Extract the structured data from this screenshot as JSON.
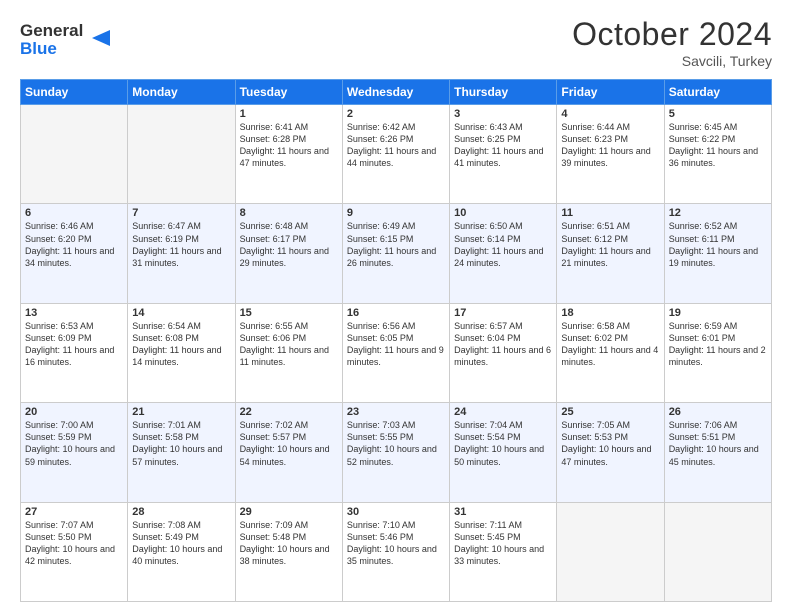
{
  "header": {
    "logo_line1": "General",
    "logo_line2": "Blue",
    "month": "October 2024",
    "location": "Savcili, Turkey"
  },
  "weekdays": [
    "Sunday",
    "Monday",
    "Tuesday",
    "Wednesday",
    "Thursday",
    "Friday",
    "Saturday"
  ],
  "weeks": [
    [
      {
        "day": "",
        "sunrise": "",
        "sunset": "",
        "daylight": ""
      },
      {
        "day": "",
        "sunrise": "",
        "sunset": "",
        "daylight": ""
      },
      {
        "day": "1",
        "sunrise": "Sunrise: 6:41 AM",
        "sunset": "Sunset: 6:28 PM",
        "daylight": "Daylight: 11 hours and 47 minutes."
      },
      {
        "day": "2",
        "sunrise": "Sunrise: 6:42 AM",
        "sunset": "Sunset: 6:26 PM",
        "daylight": "Daylight: 11 hours and 44 minutes."
      },
      {
        "day": "3",
        "sunrise": "Sunrise: 6:43 AM",
        "sunset": "Sunset: 6:25 PM",
        "daylight": "Daylight: 11 hours and 41 minutes."
      },
      {
        "day": "4",
        "sunrise": "Sunrise: 6:44 AM",
        "sunset": "Sunset: 6:23 PM",
        "daylight": "Daylight: 11 hours and 39 minutes."
      },
      {
        "day": "5",
        "sunrise": "Sunrise: 6:45 AM",
        "sunset": "Sunset: 6:22 PM",
        "daylight": "Daylight: 11 hours and 36 minutes."
      }
    ],
    [
      {
        "day": "6",
        "sunrise": "Sunrise: 6:46 AM",
        "sunset": "Sunset: 6:20 PM",
        "daylight": "Daylight: 11 hours and 34 minutes."
      },
      {
        "day": "7",
        "sunrise": "Sunrise: 6:47 AM",
        "sunset": "Sunset: 6:19 PM",
        "daylight": "Daylight: 11 hours and 31 minutes."
      },
      {
        "day": "8",
        "sunrise": "Sunrise: 6:48 AM",
        "sunset": "Sunset: 6:17 PM",
        "daylight": "Daylight: 11 hours and 29 minutes."
      },
      {
        "day": "9",
        "sunrise": "Sunrise: 6:49 AM",
        "sunset": "Sunset: 6:15 PM",
        "daylight": "Daylight: 11 hours and 26 minutes."
      },
      {
        "day": "10",
        "sunrise": "Sunrise: 6:50 AM",
        "sunset": "Sunset: 6:14 PM",
        "daylight": "Daylight: 11 hours and 24 minutes."
      },
      {
        "day": "11",
        "sunrise": "Sunrise: 6:51 AM",
        "sunset": "Sunset: 6:12 PM",
        "daylight": "Daylight: 11 hours and 21 minutes."
      },
      {
        "day": "12",
        "sunrise": "Sunrise: 6:52 AM",
        "sunset": "Sunset: 6:11 PM",
        "daylight": "Daylight: 11 hours and 19 minutes."
      }
    ],
    [
      {
        "day": "13",
        "sunrise": "Sunrise: 6:53 AM",
        "sunset": "Sunset: 6:09 PM",
        "daylight": "Daylight: 11 hours and 16 minutes."
      },
      {
        "day": "14",
        "sunrise": "Sunrise: 6:54 AM",
        "sunset": "Sunset: 6:08 PM",
        "daylight": "Daylight: 11 hours and 14 minutes."
      },
      {
        "day": "15",
        "sunrise": "Sunrise: 6:55 AM",
        "sunset": "Sunset: 6:06 PM",
        "daylight": "Daylight: 11 hours and 11 minutes."
      },
      {
        "day": "16",
        "sunrise": "Sunrise: 6:56 AM",
        "sunset": "Sunset: 6:05 PM",
        "daylight": "Daylight: 11 hours and 9 minutes."
      },
      {
        "day": "17",
        "sunrise": "Sunrise: 6:57 AM",
        "sunset": "Sunset: 6:04 PM",
        "daylight": "Daylight: 11 hours and 6 minutes."
      },
      {
        "day": "18",
        "sunrise": "Sunrise: 6:58 AM",
        "sunset": "Sunset: 6:02 PM",
        "daylight": "Daylight: 11 hours and 4 minutes."
      },
      {
        "day": "19",
        "sunrise": "Sunrise: 6:59 AM",
        "sunset": "Sunset: 6:01 PM",
        "daylight": "Daylight: 11 hours and 2 minutes."
      }
    ],
    [
      {
        "day": "20",
        "sunrise": "Sunrise: 7:00 AM",
        "sunset": "Sunset: 5:59 PM",
        "daylight": "Daylight: 10 hours and 59 minutes."
      },
      {
        "day": "21",
        "sunrise": "Sunrise: 7:01 AM",
        "sunset": "Sunset: 5:58 PM",
        "daylight": "Daylight: 10 hours and 57 minutes."
      },
      {
        "day": "22",
        "sunrise": "Sunrise: 7:02 AM",
        "sunset": "Sunset: 5:57 PM",
        "daylight": "Daylight: 10 hours and 54 minutes."
      },
      {
        "day": "23",
        "sunrise": "Sunrise: 7:03 AM",
        "sunset": "Sunset: 5:55 PM",
        "daylight": "Daylight: 10 hours and 52 minutes."
      },
      {
        "day": "24",
        "sunrise": "Sunrise: 7:04 AM",
        "sunset": "Sunset: 5:54 PM",
        "daylight": "Daylight: 10 hours and 50 minutes."
      },
      {
        "day": "25",
        "sunrise": "Sunrise: 7:05 AM",
        "sunset": "Sunset: 5:53 PM",
        "daylight": "Daylight: 10 hours and 47 minutes."
      },
      {
        "day": "26",
        "sunrise": "Sunrise: 7:06 AM",
        "sunset": "Sunset: 5:51 PM",
        "daylight": "Daylight: 10 hours and 45 minutes."
      }
    ],
    [
      {
        "day": "27",
        "sunrise": "Sunrise: 7:07 AM",
        "sunset": "Sunset: 5:50 PM",
        "daylight": "Daylight: 10 hours and 42 minutes."
      },
      {
        "day": "28",
        "sunrise": "Sunrise: 7:08 AM",
        "sunset": "Sunset: 5:49 PM",
        "daylight": "Daylight: 10 hours and 40 minutes."
      },
      {
        "day": "29",
        "sunrise": "Sunrise: 7:09 AM",
        "sunset": "Sunset: 5:48 PM",
        "daylight": "Daylight: 10 hours and 38 minutes."
      },
      {
        "day": "30",
        "sunrise": "Sunrise: 7:10 AM",
        "sunset": "Sunset: 5:46 PM",
        "daylight": "Daylight: 10 hours and 35 minutes."
      },
      {
        "day": "31",
        "sunrise": "Sunrise: 7:11 AM",
        "sunset": "Sunset: 5:45 PM",
        "daylight": "Daylight: 10 hours and 33 minutes."
      },
      {
        "day": "",
        "sunrise": "",
        "sunset": "",
        "daylight": ""
      },
      {
        "day": "",
        "sunrise": "",
        "sunset": "",
        "daylight": ""
      }
    ]
  ]
}
